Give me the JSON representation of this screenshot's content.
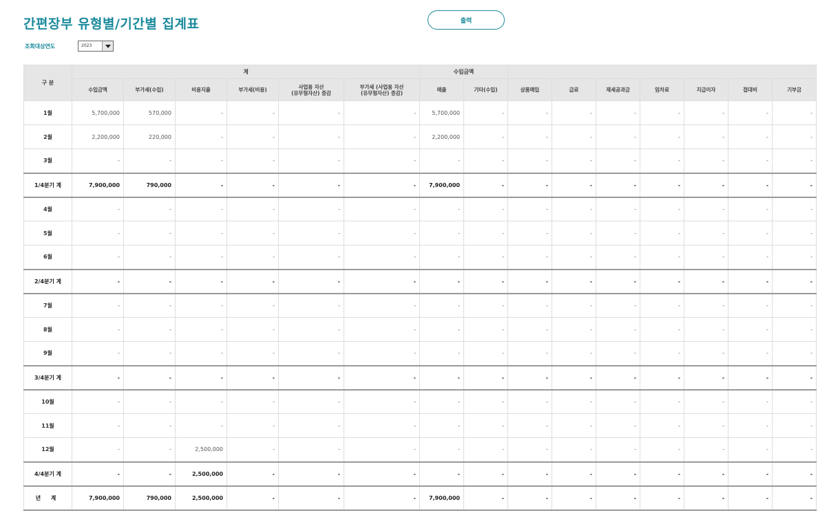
{
  "page": {
    "title": "간편장부 유형별/기간별 집계표",
    "print_label": "출력"
  },
  "filter": {
    "year_label": "조회대상연도",
    "year_value": "2023"
  },
  "table": {
    "group_headers": {
      "gubun": "구 분",
      "total": "계",
      "income": "수입금액"
    },
    "columns": [
      "수입금액",
      "부가세(수입)",
      "비용지출",
      "부가세(비용)",
      "사업용 자산\n(유무형자산) 증감",
      "부가세 (사업용 자산\n(유무형자산) 증감)",
      "매출",
      "기타(수입)",
      "상품매입",
      "급료",
      "제세공과금",
      "임차료",
      "지급이자",
      "접대비",
      "기부금"
    ],
    "rows": [
      {
        "label": "1월",
        "type": "month",
        "cells": [
          "5,700,000",
          "570,000",
          "-",
          "-",
          "-",
          "-",
          "5,700,000",
          "-",
          "-",
          "-",
          "-",
          "-",
          "-",
          "-",
          "-"
        ]
      },
      {
        "label": "2월",
        "type": "month",
        "cells": [
          "2,200,000",
          "220,000",
          "-",
          "-",
          "-",
          "-",
          "2,200,000",
          "-",
          "-",
          "-",
          "-",
          "-",
          "-",
          "-",
          "-"
        ]
      },
      {
        "label": "3월",
        "type": "month",
        "cells": [
          "-",
          "-",
          "-",
          "-",
          "-",
          "-",
          "-",
          "-",
          "-",
          "-",
          "-",
          "-",
          "-",
          "-",
          "-"
        ]
      },
      {
        "label": "1/4분기 계",
        "type": "sub",
        "cells": [
          "7,900,000",
          "790,000",
          "-",
          "-",
          "-",
          "-",
          "7,900,000",
          "-",
          "-",
          "-",
          "-",
          "-",
          "-",
          "-",
          "-"
        ]
      },
      {
        "label": "4월",
        "type": "month",
        "cells": [
          "-",
          "-",
          "-",
          "-",
          "-",
          "-",
          "-",
          "-",
          "-",
          "-",
          "-",
          "-",
          "-",
          "-",
          "-"
        ]
      },
      {
        "label": "5월",
        "type": "month",
        "cells": [
          "-",
          "-",
          "-",
          "-",
          "-",
          "-",
          "-",
          "-",
          "-",
          "-",
          "-",
          "-",
          "-",
          "-",
          "-"
        ]
      },
      {
        "label": "6월",
        "type": "month",
        "cells": [
          "-",
          "-",
          "-",
          "-",
          "-",
          "-",
          "-",
          "-",
          "-",
          "-",
          "-",
          "-",
          "-",
          "-",
          "-"
        ]
      },
      {
        "label": "2/4분기 계",
        "type": "sub",
        "cells": [
          "-",
          "-",
          "-",
          "-",
          "-",
          "-",
          "-",
          "-",
          "-",
          "-",
          "-",
          "-",
          "-",
          "-",
          "-"
        ]
      },
      {
        "label": "7월",
        "type": "month",
        "cells": [
          "-",
          "-",
          "-",
          "-",
          "-",
          "-",
          "-",
          "-",
          "-",
          "-",
          "-",
          "-",
          "-",
          "-",
          "-"
        ]
      },
      {
        "label": "8월",
        "type": "month",
        "cells": [
          "-",
          "-",
          "-",
          "-",
          "-",
          "-",
          "-",
          "-",
          "-",
          "-",
          "-",
          "-",
          "-",
          "-",
          "-"
        ]
      },
      {
        "label": "9월",
        "type": "month",
        "cells": [
          "-",
          "-",
          "-",
          "-",
          "-",
          "-",
          "-",
          "-",
          "-",
          "-",
          "-",
          "-",
          "-",
          "-",
          "-"
        ]
      },
      {
        "label": "3/4분기 계",
        "type": "sub",
        "cells": [
          "-",
          "-",
          "-",
          "-",
          "-",
          "-",
          "-",
          "-",
          "-",
          "-",
          "-",
          "-",
          "-",
          "-",
          "-"
        ]
      },
      {
        "label": "10월",
        "type": "month",
        "cells": [
          "-",
          "-",
          "-",
          "-",
          "-",
          "-",
          "-",
          "-",
          "-",
          "-",
          "-",
          "-",
          "-",
          "-",
          "-"
        ]
      },
      {
        "label": "11월",
        "type": "month",
        "cells": [
          "-",
          "-",
          "-",
          "-",
          "-",
          "-",
          "-",
          "-",
          "-",
          "-",
          "-",
          "-",
          "-",
          "-",
          "-"
        ]
      },
      {
        "label": "12월",
        "type": "month",
        "cells": [
          "-",
          "-",
          "2,500,000",
          "-",
          "-",
          "-",
          "-",
          "-",
          "-",
          "-",
          "-",
          "-",
          "-",
          "-",
          "-"
        ]
      },
      {
        "label": "4/4분기 계",
        "type": "sub",
        "cells": [
          "-",
          "-",
          "2,500,000",
          "-",
          "-",
          "-",
          "-",
          "-",
          "-",
          "-",
          "-",
          "-",
          "-",
          "-",
          "-"
        ]
      },
      {
        "label": "년 계",
        "type": "total",
        "cells": [
          "7,900,000",
          "790,000",
          "2,500,000",
          "-",
          "-",
          "-",
          "7,900,000",
          "-",
          "-",
          "-",
          "-",
          "-",
          "-",
          "-",
          "-"
        ]
      }
    ]
  }
}
